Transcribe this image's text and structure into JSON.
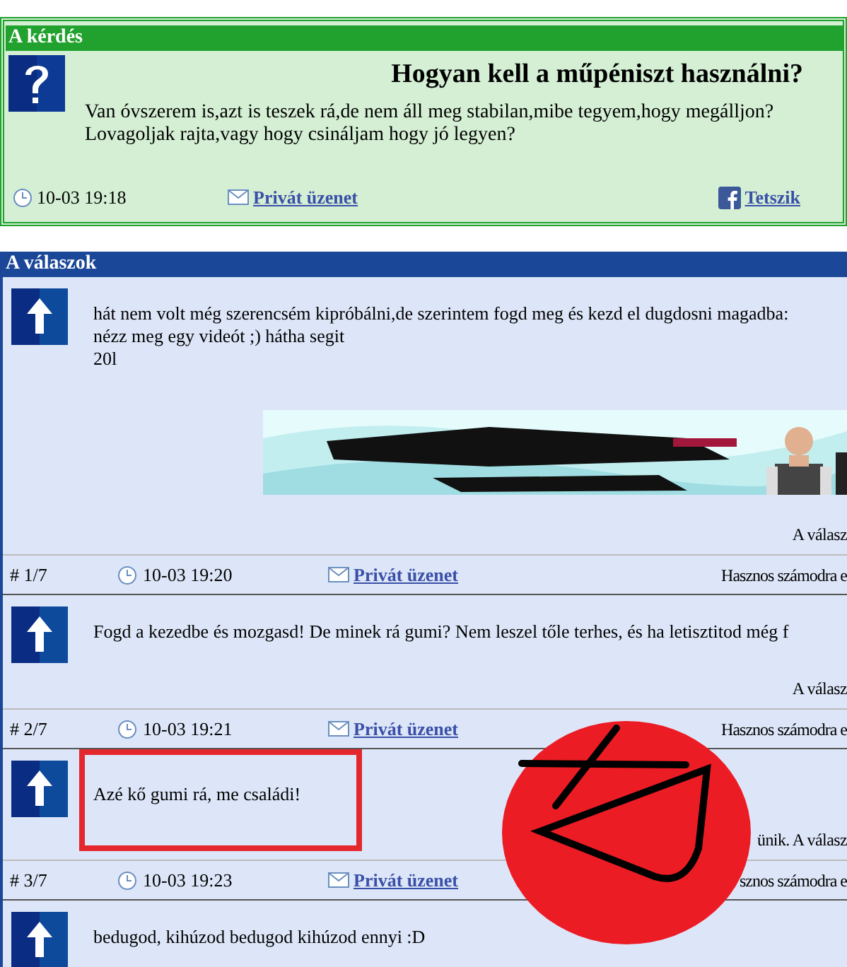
{
  "question": {
    "header": "A kérdés",
    "title": "Hogyan kell a műpéniszt használni?",
    "body": [
      "Van óvszerem is,azt is teszek rá,de nem áll meg stabilan,mibe tegyem,hogy megálljon?",
      "Lovagoljak rajta,vagy hogy csináljam hogy jó legyen?"
    ],
    "time": "10-03 19:18",
    "message_link": "Privát üzenet",
    "like_link": "Tetszik"
  },
  "answers_header": "A válaszok",
  "answers": [
    {
      "lines": [
        "hát nem volt még szerencsém kipróbálni,de szerintem fogd meg és kezd el dugdosni magadba:",
        "nézz meg egy videót ;) hátha segit",
        "20l"
      ],
      "media": {
        "kind": "picture"
      },
      "note": "A válasz",
      "number": "# 1/7",
      "time": "10-03 19:20",
      "message_link": "Privát üzenet",
      "useful": "Hasznos számodra e",
      "highlighted": false
    },
    {
      "lines": [
        "Fogd a kezedbe és mozgasd! De minek rá gumi? Nem leszel tőle terhes, és ha letisztitod még f"
      ],
      "note": "A válasz",
      "number": "# 2/7",
      "time": "10-03 19:21",
      "message_link": "Privát üzenet",
      "useful": "Hasznos számodra e",
      "highlighted": false
    },
    {
      "lines": [
        "Azé kő gumi rá, me családi!"
      ],
      "note": "ünik. A válasz",
      "number": "# 3/7",
      "time": "10-03 19:23",
      "message_link": "Privát üzenet",
      "useful": "sznos számodra e",
      "highlighted": true
    },
    {
      "lines": [
        "bedugod, kihúzod bedugod kihúzod ennyi :D"
      ],
      "highlighted": false
    }
  ],
  "annotations": [
    {
      "kind": "circle_scribble"
    }
  ]
}
